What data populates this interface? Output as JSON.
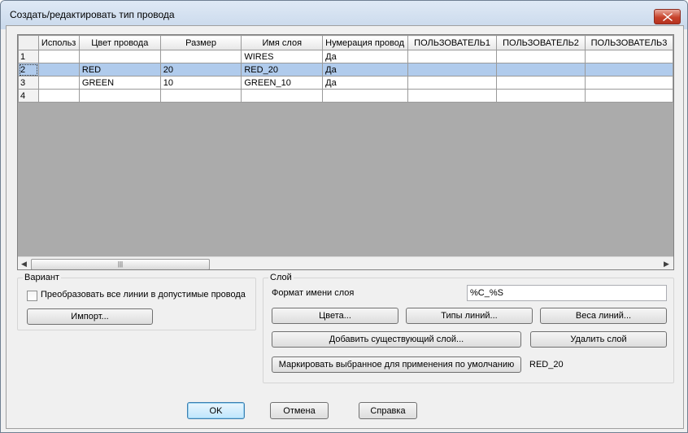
{
  "window": {
    "title": "Создать/редактировать тип провода"
  },
  "grid": {
    "columns": [
      "Использ",
      "Цвет провода",
      "Размер",
      "Имя слоя",
      "Нумерация провод",
      "ПОЛЬЗОВАТЕЛЬ1",
      "ПОЛЬЗОВАТЕЛЬ2",
      "ПОЛЬЗОВАТЕЛЬ3"
    ],
    "rows": [
      {
        "num": "1",
        "cells": [
          "",
          "",
          "",
          "WIRES",
          "Да",
          "",
          "",
          ""
        ]
      },
      {
        "num": "2",
        "cells": [
          "",
          "RED",
          "20",
          "RED_20",
          "Да",
          "",
          "",
          ""
        ],
        "selected": true
      },
      {
        "num": "3",
        "cells": [
          "",
          "GREEN",
          "10",
          "GREEN_10",
          "Да",
          "",
          "",
          ""
        ]
      },
      {
        "num": "4",
        "cells": [
          "",
          "",
          "",
          "",
          "",
          "",
          "",
          ""
        ]
      }
    ]
  },
  "variant": {
    "title": "Вариант",
    "convert_label": "Преобразовать все линии в допустимые провода",
    "import_button": "Импорт..."
  },
  "layer": {
    "title": "Слой",
    "format_label": "Формат имени слоя",
    "format_value": "%C_%S",
    "colors_button": "Цвета...",
    "linetypes_button": "Типы линий...",
    "lineweights_button": "Веса линий...",
    "add_layer_button": "Добавить существующий слой...",
    "delete_layer_button": "Удалить слой",
    "mark_default_button": "Маркировать выбранное для применения по умолчанию",
    "default_value": "RED_20"
  },
  "footer": {
    "ok": "OK",
    "cancel": "Отмена",
    "help": "Справка"
  }
}
